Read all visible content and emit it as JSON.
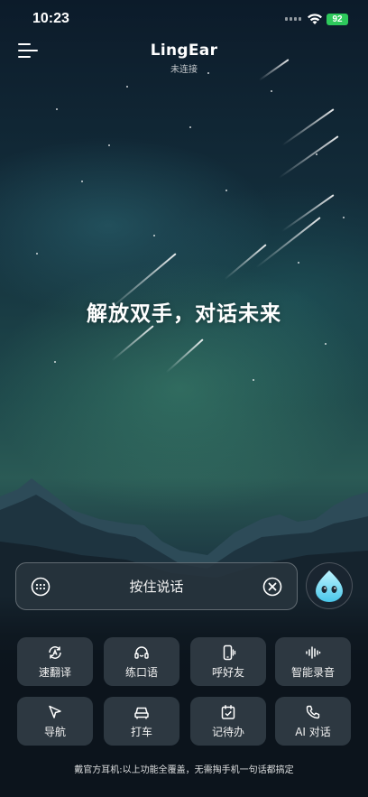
{
  "status_bar": {
    "time": "10:23",
    "battery": "92"
  },
  "header": {
    "title": "LingEar",
    "subtitle": "未连接"
  },
  "hero": {
    "slogan": "解放双手，对话未来"
  },
  "voice_bar": {
    "label": "按住说话"
  },
  "features": [
    {
      "label": "速翻译",
      "icon": "translate-icon"
    },
    {
      "label": "练口语",
      "icon": "headset-icon"
    },
    {
      "label": "呼好友",
      "icon": "phone-vibrate-icon"
    },
    {
      "label": "智能录音",
      "icon": "waveform-icon"
    },
    {
      "label": "导航",
      "icon": "navigation-arrow-icon"
    },
    {
      "label": "打车",
      "icon": "car-icon"
    },
    {
      "label": "记待办",
      "icon": "calendar-check-icon"
    },
    {
      "label": "AI 对话",
      "icon": "phone-call-icon"
    }
  ],
  "footer": {
    "text": "戴官方耳机:以上功能全覆盖，无需掏手机一句话都搞定"
  },
  "colors": {
    "battery": "#2ec95c",
    "panel": "#0c141c",
    "tile": "#343e48"
  }
}
